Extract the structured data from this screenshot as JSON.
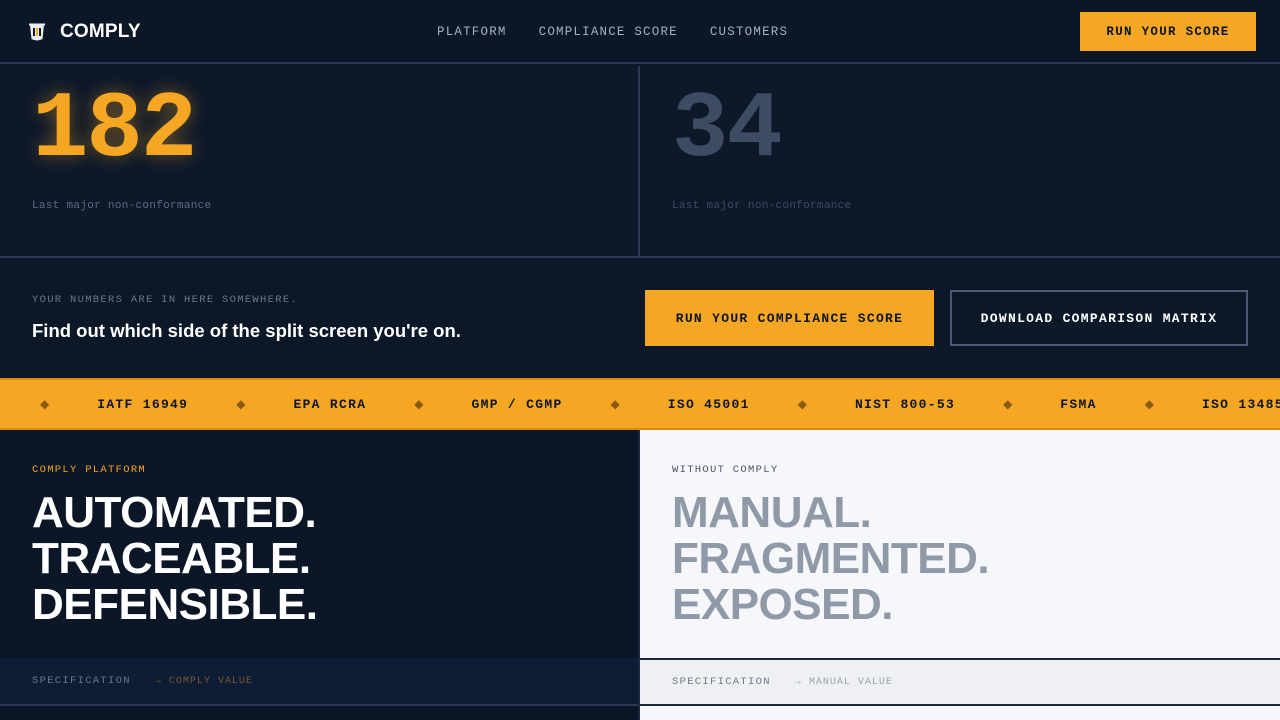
{
  "header": {
    "logo_text": "COMPLY",
    "logo_icon": "shield-bucket-icon",
    "nav": [
      {
        "label": "PLATFORM"
      },
      {
        "label": "COMPLIANCE SCORE"
      },
      {
        "label": "CUSTOMERS"
      }
    ],
    "cta_label": "RUN YOUR SCORE"
  },
  "stats": {
    "left": {
      "value": "182",
      "label": "Last major non-conformance"
    },
    "right": {
      "value": "34",
      "label": "Last major non-conformance"
    }
  },
  "cta_band": {
    "eyebrow": "YOUR NUMBERS ARE IN HERE SOMEWHERE.",
    "headline": "Find out which side of the split screen you're on.",
    "primary_button": "RUN YOUR COMPLIANCE SCORE",
    "secondary_button": "DOWNLOAD COMPARISON MATRIX"
  },
  "ticker": {
    "separator": "◆",
    "items": [
      "IATF 16949",
      "EPA RCRA",
      "GMP / CGMP",
      "ISO 45001",
      "NIST 800-53",
      "FSMA",
      "ISO 13485"
    ]
  },
  "split": {
    "left": {
      "eyebrow": "COMPLY PLATFORM",
      "lines": [
        "AUTOMATED.",
        "TRACEABLE.",
        "DEFENSIBLE."
      ],
      "spec_key": "SPECIFICATION",
      "spec_value": "→ COMPLY VALUE"
    },
    "right": {
      "eyebrow": "WITHOUT COMPLY",
      "lines": [
        "MANUAL.",
        "FRAGMENTED.",
        "EXPOSED."
      ],
      "spec_key": "SPECIFICATION",
      "spec_value": "→ MANUAL VALUE"
    }
  },
  "colors": {
    "accent": "#f5a623",
    "background": "#0d1829",
    "light_panel": "#f5f7fa"
  }
}
